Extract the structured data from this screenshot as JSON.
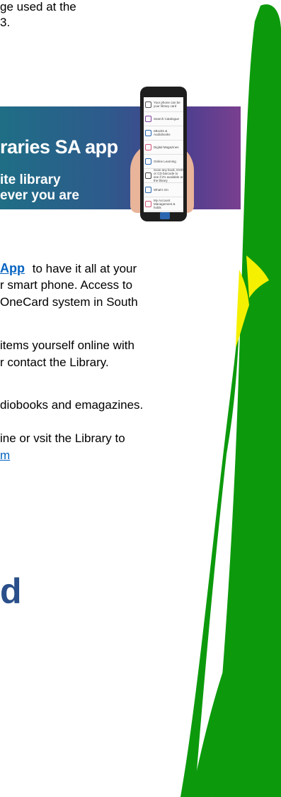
{
  "top_text": {
    "line1": "ge used at the",
    "line2": "3."
  },
  "banner": {
    "title": "raries SA app",
    "subtitle_line1": "ite library",
    "subtitle_line2": "ever you are"
  },
  "phone_menu": [
    {
      "label": "Your phone can be your library card",
      "icon": "barcode-icon",
      "color": "#555555"
    },
    {
      "label": "Search Catalogue",
      "icon": "search-icon",
      "color": "#7a3f9a"
    },
    {
      "label": "eBooks & Audiobooks",
      "icon": "ebook-icon",
      "color": "#2a66b0"
    },
    {
      "label": "Digital Magazines",
      "icon": "magazine-icon",
      "color": "#d2567a"
    },
    {
      "label": "Online Learning",
      "icon": "graduation-cap-icon",
      "color": "#2a66b0"
    },
    {
      "label": "Scan any book, DVD or CD barcode to see if it's available at the library",
      "icon": "scan-icon",
      "color": "#444444"
    },
    {
      "label": "What's On",
      "icon": "calendar-icon",
      "color": "#2a66b0"
    },
    {
      "label": "My Account Management & holds",
      "icon": "account-icon",
      "color": "#d2567a"
    }
  ],
  "paragraphs": {
    "p1": {
      "link_text": "App",
      "line1_rest": "to have it all at your",
      "line2": "r smart phone.  Access to",
      "line3": "OneCard system in South"
    },
    "p2": {
      "line1": "items yourself online with",
      "line2": "r contact the Library."
    },
    "p3": {
      "line1": "diobooks and emagazines."
    },
    "p4": {
      "line1": "ine or vsit the Library to",
      "line2_link": "m"
    }
  },
  "bottom_fragment": "d",
  "colors": {
    "link": "#0563c1",
    "grass": "#0c9a0c",
    "grass_highlight": "#f5f000",
    "bottom_fragment": "#2a4f8a"
  }
}
